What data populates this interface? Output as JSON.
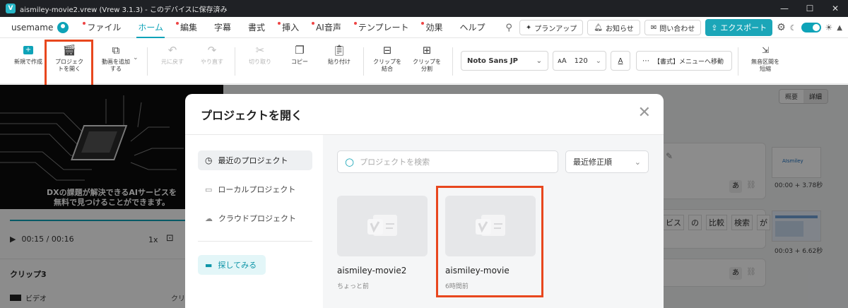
{
  "titlebar": {
    "title": "aismiley-movie2.vrew (Vrew 3.1.3) - このデバイスに保存済み",
    "app_icon": "V"
  },
  "menubar": {
    "username": "usemame",
    "tabs": [
      "ファイル",
      "ホーム",
      "編集",
      "字幕",
      "書式",
      "挿入",
      "AI音声",
      "テンプレート",
      "効果",
      "ヘルプ"
    ],
    "active_tab": "ホーム",
    "plan_up": "プランアップ",
    "notice": "お知らせ",
    "contact": "問い合わせ",
    "export": "エクスポート"
  },
  "toolbar": {
    "new": "新規で作成",
    "open": "プロジェクトを開く",
    "add_video": "動画を追加する",
    "undo": "元に戻す",
    "redo": "やり直す",
    "cut": "切り取り",
    "copy": "コピー",
    "paste": "貼り付け",
    "merge": "クリップを結合",
    "split": "クリップを分割",
    "font": "Noto Sans JP",
    "font_size": "120",
    "format_menu": "【書式】メニューへ移動",
    "shorten": "無音区間を短縮"
  },
  "preview": {
    "caption_line1": "DXの課題が解決できるAIサービスを",
    "caption_line2": "無料で見つけることができます。",
    "time": "00:15 / 00:16",
    "speed": "1x"
  },
  "clip_panel": {
    "title": "クリップ3",
    "row_label": "ビデオ",
    "truncated": "クリ"
  },
  "view_toggle": {
    "summary": "概要",
    "detail": "詳細"
  },
  "right_panel": {
    "thumb1_time": "00:00 + 3.78秒",
    "thumb2_time": "00:03 + 6.62秒",
    "words": [
      "ビス",
      "の",
      "比較",
      "検索",
      "が"
    ],
    "lang": "あ",
    "logo_text": "AIsmiley"
  },
  "modal": {
    "title": "プロジェクトを開く",
    "sidebar": [
      "最近のプロジェクト",
      "ローカルプロジェクト",
      "クラウドプロジェクト"
    ],
    "explore": "探してみる",
    "search_placeholder": "プロジェクトを検索",
    "sort": "最近修正順",
    "projects": [
      {
        "name": "aismiley-movie2",
        "time": "ちょっと前"
      },
      {
        "name": "aismiley-movie",
        "time": "6時間前"
      }
    ]
  },
  "colors": {
    "accent": "#0ea3b8",
    "highlight": "#e8471e"
  }
}
